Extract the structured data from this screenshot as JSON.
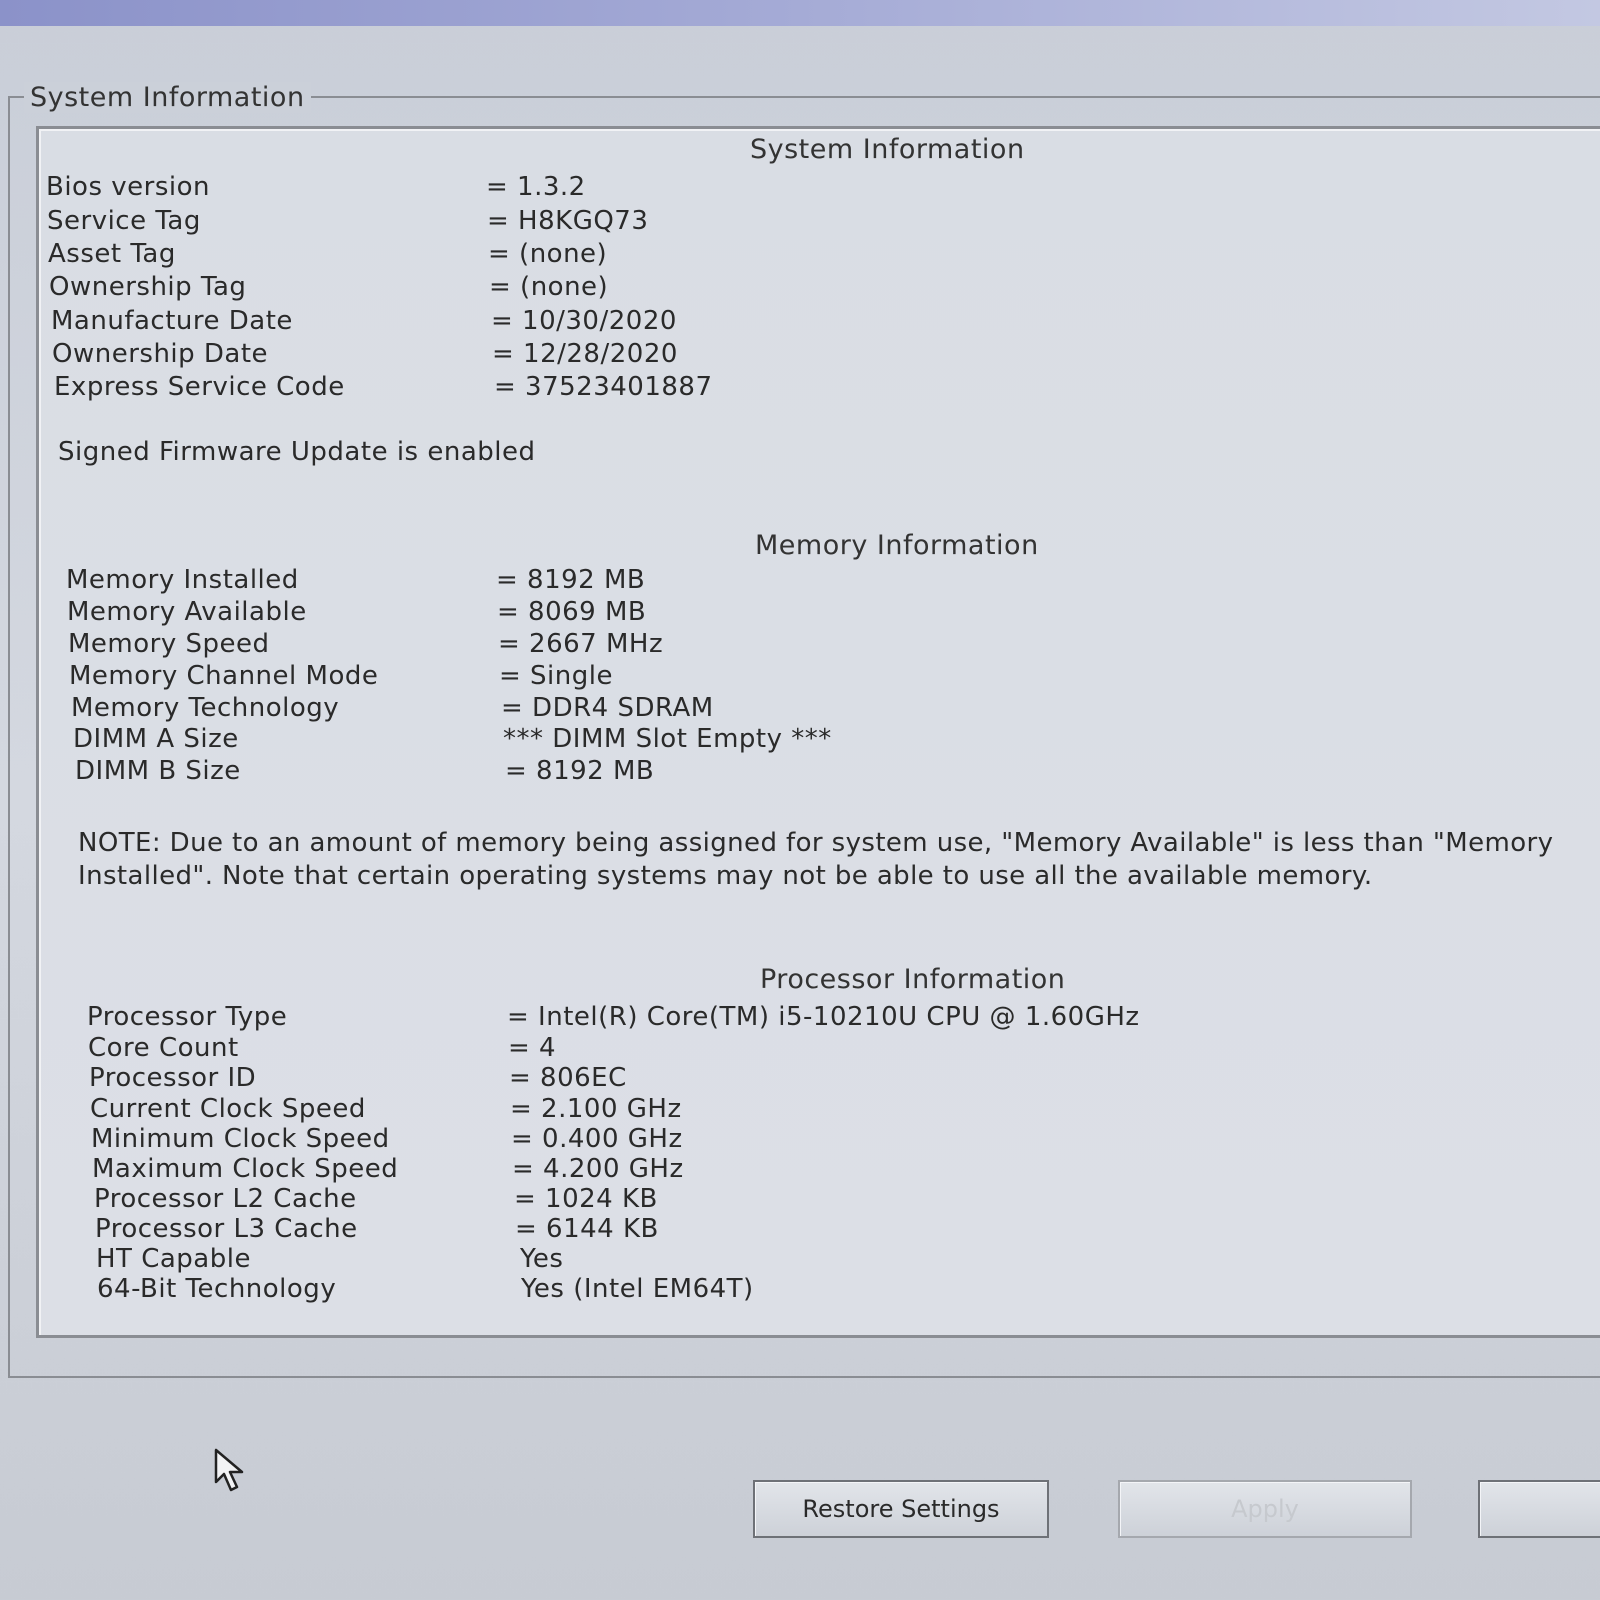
{
  "group_title": "System Information",
  "system": {
    "title": "System Information",
    "rows": [
      {
        "label": "Bios version",
        "value": "= 1.3.2"
      },
      {
        "label": "Service Tag",
        "value": "= H8KGQ73"
      },
      {
        "label": "Asset Tag",
        "value": "= (none)"
      },
      {
        "label": "Ownership Tag",
        "value": "= (none)"
      },
      {
        "label": "Manufacture Date",
        "value": "= 10/30/2020"
      },
      {
        "label": "Ownership Date",
        "value": "= 12/28/2020"
      },
      {
        "label": "Express Service Code",
        "value": "= 37523401887"
      }
    ],
    "status": "Signed Firmware Update is enabled"
  },
  "memory": {
    "title": "Memory Information",
    "rows": [
      {
        "label": "Memory Installed",
        "value": "= 8192 MB"
      },
      {
        "label": "Memory Available",
        "value": "= 8069 MB"
      },
      {
        "label": "Memory Speed",
        "value": "= 2667 MHz"
      },
      {
        "label": "Memory Channel Mode",
        "value": "= Single"
      },
      {
        "label": "Memory Technology",
        "value": "= DDR4 SDRAM"
      },
      {
        "label": "DIMM A Size",
        "value": "*** DIMM Slot Empty ***"
      },
      {
        "label": "DIMM B Size",
        "value": "= 8192 MB"
      }
    ],
    "note": "NOTE: Due to an amount of memory being assigned for system use, \"Memory Available\" is less than \"Memory Installed\". Note that certain operating systems may not be able to use all the available memory."
  },
  "processor": {
    "title": "Processor Information",
    "rows": [
      {
        "label": "Processor Type",
        "value": "= Intel(R) Core(TM) i5-10210U CPU @ 1.60GHz"
      },
      {
        "label": "Core Count",
        "value": "= 4"
      },
      {
        "label": "Processor ID",
        "value": "= 806EC"
      },
      {
        "label": "Current Clock Speed",
        "value": "= 2.100 GHz"
      },
      {
        "label": "Minimum Clock Speed",
        "value": "= 0.400 GHz"
      },
      {
        "label": "Maximum Clock Speed",
        "value": "= 4.200 GHz"
      },
      {
        "label": "Processor L2 Cache",
        "value": "= 1024 KB"
      },
      {
        "label": "Processor L3 Cache",
        "value": "= 6144 KB"
      },
      {
        "label": "HT Capable",
        "value": "Yes"
      },
      {
        "label": "64-Bit Technology",
        "value": "Yes (Intel EM64T)"
      }
    ]
  },
  "buttons": {
    "restore": "Restore Settings",
    "apply": "Apply",
    "third": ""
  },
  "icons": {
    "cursor": "mouse-pointer-icon"
  }
}
